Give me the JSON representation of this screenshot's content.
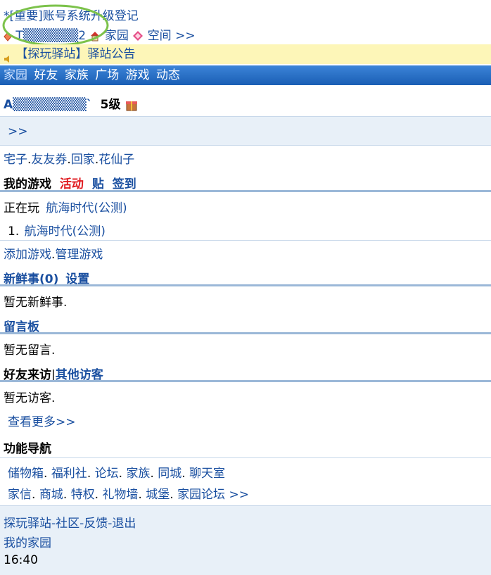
{
  "top": {
    "notice_link": "*[重要]账号系统升级登记",
    "user_id": "T▒▒▒▒▒▒2",
    "home_link": "家园",
    "space_link": "空间 >>"
  },
  "banner": {
    "text": "【探玩驿站】驿站公告"
  },
  "nav": {
    "items": [
      "家园",
      "好友",
      "家族",
      "广场",
      "游戏",
      "动态"
    ]
  },
  "profile": {
    "name": "A▒▒▒▒▒▒▒▒`",
    "level": "5级",
    "more": ">>"
  },
  "links1": [
    "宅子",
    "友友券",
    "回家",
    "花仙子"
  ],
  "my_games": {
    "title": "我的游戏",
    "activity": "活动",
    "post": "贴",
    "signin": "签到",
    "playing_label": "正在玩",
    "playing_game": "航海时代(公测)",
    "list_index": "1.",
    "list_game": "航海时代(公测)",
    "add_game": "添加游戏",
    "manage_game": "管理游戏"
  },
  "news": {
    "title": "新鲜事(0)",
    "settings": "设置",
    "empty": "暂无新鲜事."
  },
  "guestbook": {
    "title": "留言板",
    "empty": "暂无留言."
  },
  "visitors": {
    "title": "好友来访",
    "other": "其他访客",
    "empty": "暂无访客.",
    "more": "查看更多>>"
  },
  "func_nav": {
    "title": "功能导航",
    "row1": [
      "储物箱",
      "福利社",
      "论坛",
      "家族",
      "同城",
      "聊天室"
    ],
    "row2": [
      "家信",
      "商城",
      "特权",
      "礼物墙",
      "城堡",
      "家园论坛 >>"
    ]
  },
  "footer": {
    "links": [
      "探玩驿站",
      "社区",
      "反馈",
      "退出"
    ],
    "my_home": "我的家园",
    "time": "16:40"
  },
  "colors": {
    "link": "#1a4fa0",
    "nav_bg": "#1f69c2",
    "banner_bg": "#fdf6b8",
    "panel_bg": "#e8f0f8",
    "red": "#e0191e",
    "highlight_circle": "#7cc24a"
  }
}
